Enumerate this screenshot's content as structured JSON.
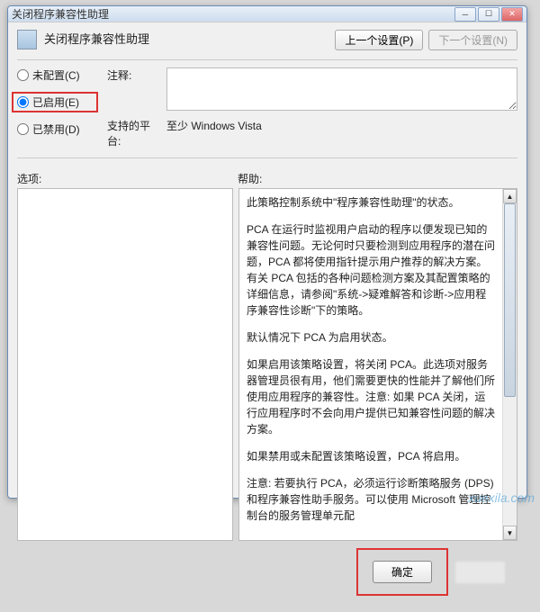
{
  "window": {
    "title": "关闭程序兼容性助理"
  },
  "winbtns": {
    "min": "─",
    "max": "☐",
    "close": "✕"
  },
  "header": {
    "title": "关闭程序兼容性助理"
  },
  "nav": {
    "prev": "上一个设置(P)",
    "next": "下一个设置(N)"
  },
  "radios": {
    "none": "未配置(C)",
    "enabled": "已启用(E)",
    "disabled": "已禁用(D)"
  },
  "form": {
    "comment_label": "注释:",
    "platform_label": "支持的平台:",
    "platform_value": "至少 Windows Vista"
  },
  "labels": {
    "options": "选项:",
    "help": "帮助:"
  },
  "help": {
    "p1": "此策略控制系统中\"程序兼容性助理\"的状态。",
    "p2": "PCA 在运行时监视用户启动的程序以便发现已知的兼容性问题。无论何时只要检测到应用程序的潜在问题，PCA 都将使用指针提示用户推荐的解决方案。有关 PCA 包括的各种问题检测方案及其配置策略的详细信息，请参阅\"系统->疑难解答和诊断->应用程序兼容性诊断\"下的策略。",
    "p3": "默认情况下 PCA 为启用状态。",
    "p4": "如果启用该策略设置，将关闭 PCA。此选项对服务器管理员很有用，他们需要更快的性能并了解他们所使用应用程序的兼容性。注意: 如果 PCA 关闭，运行应用程序时不会向用户提供已知兼容性问题的解决方案。",
    "p5": "如果禁用或未配置该策略设置，PCA 将启用。",
    "p6": "注意: 若要执行 PCA，必须运行诊断策略服务 (DPS) 和程序兼容性助手服务。可以使用 Microsoft 管理控制台的服务管理单元配"
  },
  "footer": {
    "ok": "确定"
  },
  "scrollbar": {
    "up": "▲",
    "down": "▼"
  },
  "watermark": "xuexila.com"
}
